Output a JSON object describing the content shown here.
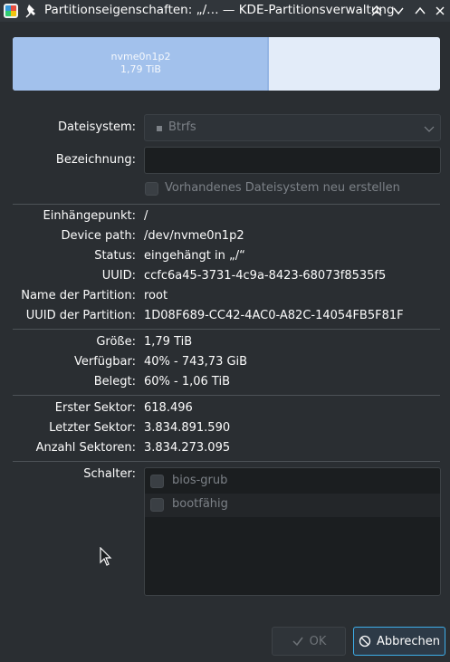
{
  "window": {
    "title": "Partitionseigenschaften: „/… — KDE-Partitionsverwaltung",
    "icons": [
      "app-icon",
      "pin-icon",
      "keep-above-icon",
      "minimize-icon",
      "maximize-icon",
      "close-icon"
    ]
  },
  "partition_bar": {
    "name": "nvme0n1p2",
    "size": "1,79 TiB",
    "used_fraction": 0.6,
    "colors": {
      "used": "#a2c1ec",
      "free": "#e3ecf9"
    }
  },
  "form": {
    "filesystem_label": "Dateisystem:",
    "filesystem_value": "Btrfs",
    "label_label": "Bezeichnung:",
    "label_value": "",
    "recreate_label": "Vorhandenes Dateisystem neu erstellen"
  },
  "info": {
    "mountpoint_label": "Einhängepunkt:",
    "mountpoint_value": "/",
    "device_label": "Device path:",
    "device_value": "/dev/nvme0n1p2",
    "status_label": "Status:",
    "status_value": "eingehängt in „/“",
    "uuid_label": "UUID:",
    "uuid_value": "ccfc6a45-3731-4c9a-8423-68073f8535f5",
    "partname_label": "Name der Partition:",
    "partname_value": "root",
    "partuuid_label": "UUID der Partition:",
    "partuuid_value": "1D08F689-CC42-4AC0-A82C-14054FB5F81F"
  },
  "size": {
    "size_label": "Größe:",
    "size_value": "1,79 TiB",
    "avail_label": "Verfügbar:",
    "avail_value": "40% - 743,73 GiB",
    "used_label": "Belegt:",
    "used_value": "60% - 1,06 TiB"
  },
  "sectors": {
    "first_label": "Erster Sektor:",
    "first_value": "618.496",
    "last_label": "Letzter Sektor:",
    "last_value": "3.834.891.590",
    "count_label": "Anzahl Sektoren:",
    "count_value": "3.834.273.095"
  },
  "flags": {
    "label": "Schalter:",
    "items": [
      {
        "label": "bios-grub"
      },
      {
        "label": "bootfähig"
      }
    ]
  },
  "buttons": {
    "ok": "OK",
    "cancel": "Abbrechen"
  },
  "accent_color": "#3daee9"
}
